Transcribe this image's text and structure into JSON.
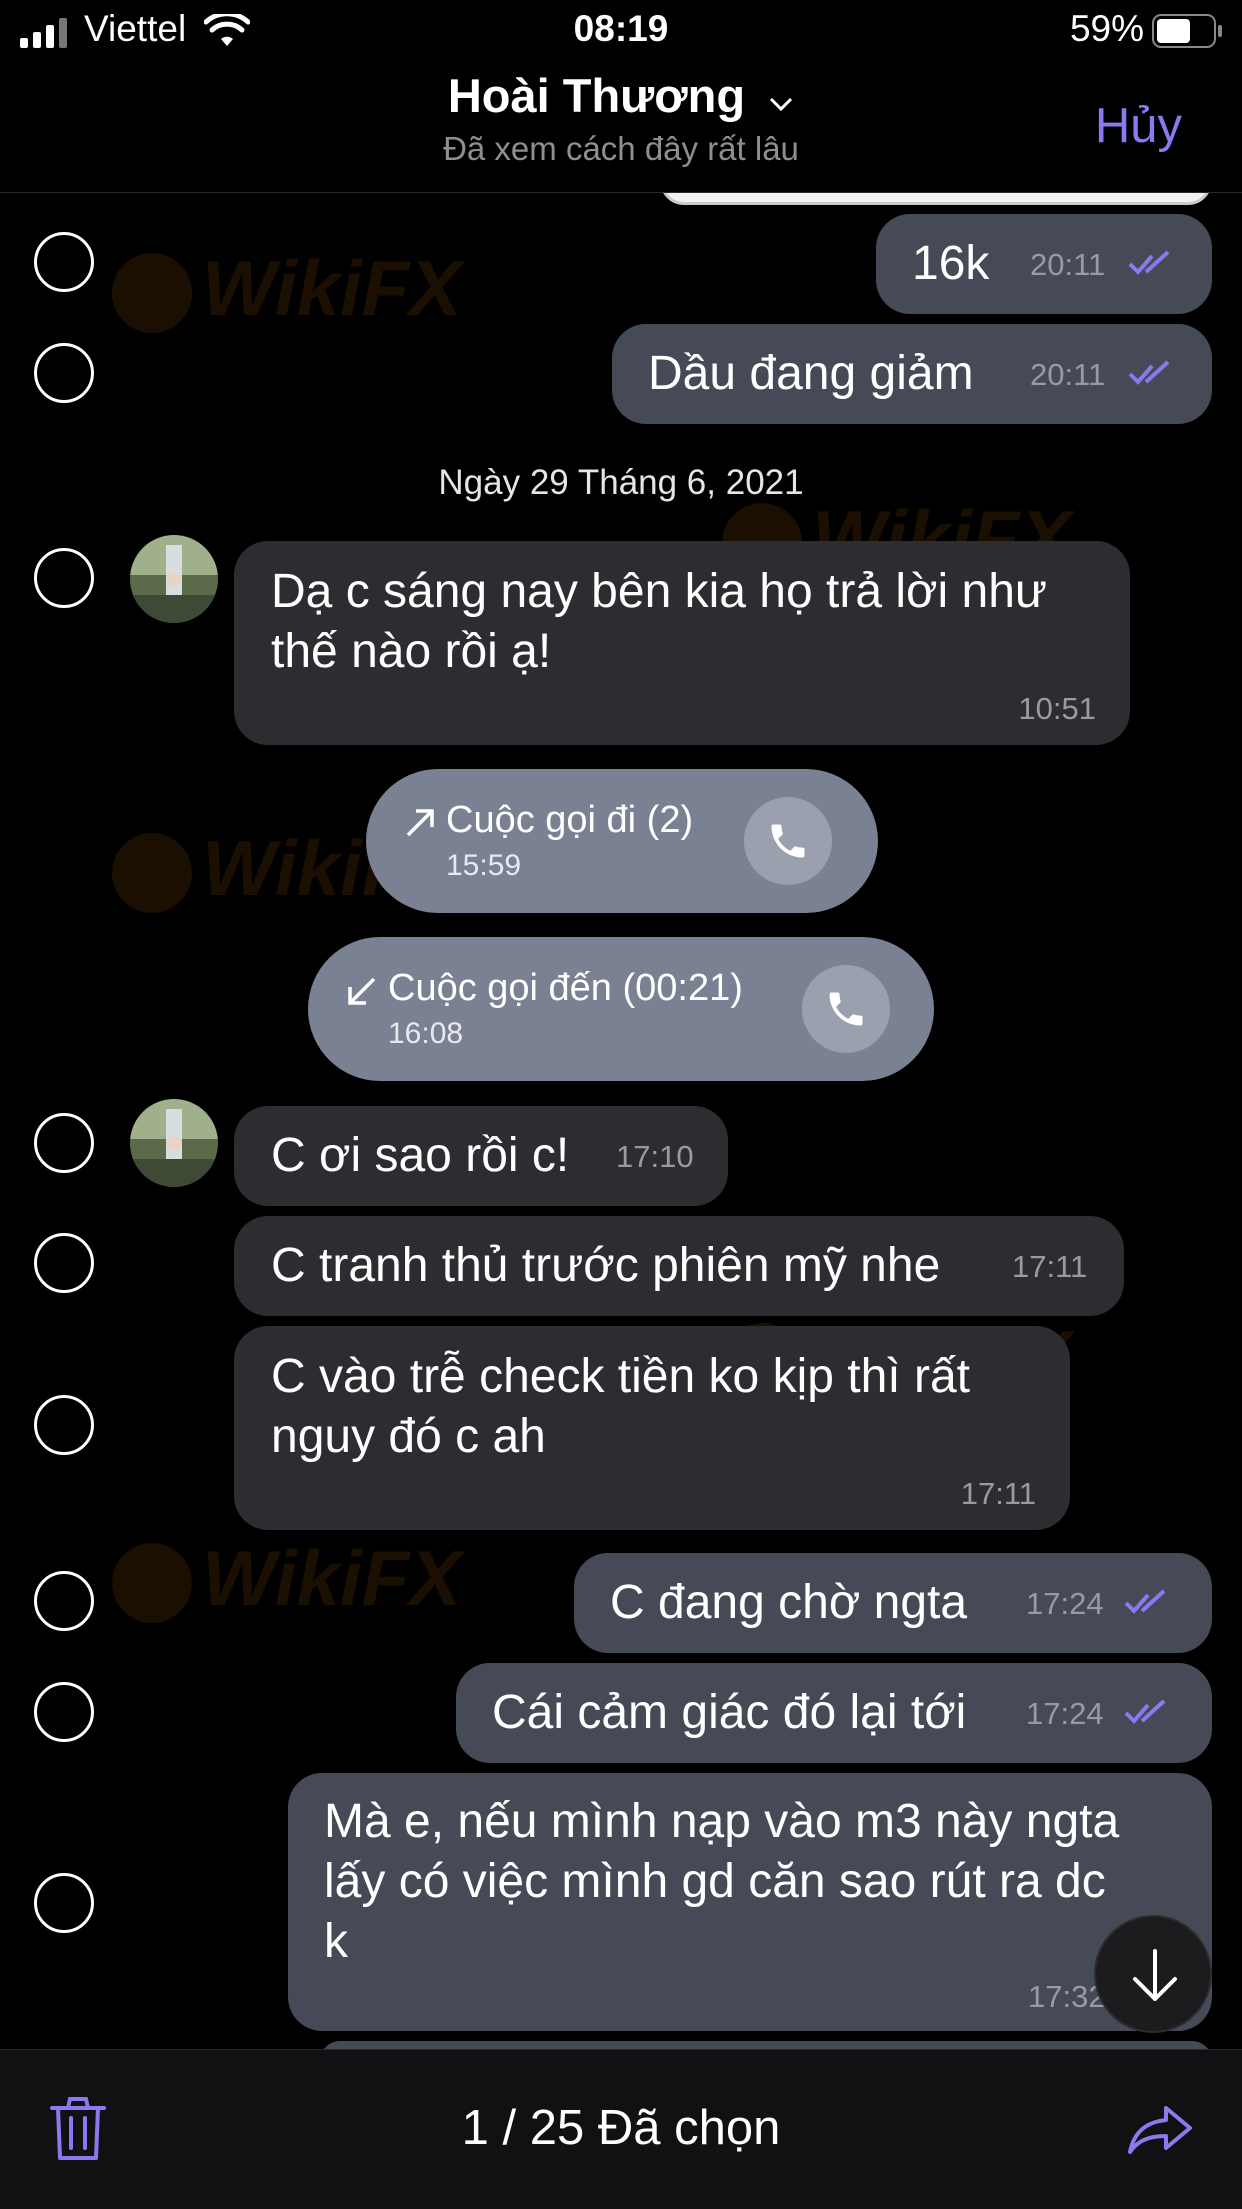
{
  "status_bar": {
    "carrier": "Viettel",
    "time": "08:19",
    "battery": "59%"
  },
  "header": {
    "title": "Hoài Thương",
    "subtitle": "Đã xem cách đây rất lâu",
    "cancel": "Hủy"
  },
  "messages": [
    {
      "text": "16k",
      "time": "20:11",
      "direction": "out"
    },
    {
      "text": "Dầu đang giảm",
      "time": "20:11",
      "direction": "out"
    },
    {
      "text_line1": "Dạ c sáng nay bên kia họ trả lời như",
      "text_line2": "thế nào rồi ạ!",
      "time": "10:51",
      "direction": "in"
    },
    {
      "text": "C ơi sao rồi c!",
      "time": "17:10",
      "direction": "in"
    },
    {
      "text": "C tranh thủ trước phiên mỹ nhe",
      "time": "17:11",
      "direction": "in"
    },
    {
      "text_line1": "C vào trễ check tiền ko kịp thì rất",
      "text_line2": "nguy đó c ah",
      "time": "17:11",
      "direction": "in"
    },
    {
      "text": "C đang chờ ngta",
      "time": "17:24",
      "direction": "out"
    },
    {
      "text": "Cái cảm giác đó lại tới",
      "time": "17:24",
      "direction": "out"
    },
    {
      "text_line1": "Mà e, nếu mình nạp vào m3 này ngta",
      "text_line2": "lấy có việc mình gd căn sao rút ra dc",
      "text_line3": "k",
      "time": "17:32",
      "direction": "out"
    }
  ],
  "date_separator": "Ngày 29 Tháng 6, 2021",
  "calls": [
    {
      "label": "Cuộc gọi đi (2)",
      "time": "15:59",
      "direction": "outgoing"
    },
    {
      "label": "Cuộc gọi đến (00:21)",
      "time": "16:08",
      "direction": "incoming"
    }
  ],
  "bottom_bar": {
    "selected": "1 / 25 Đã chọn"
  },
  "watermark": "WikiFX",
  "colors": {
    "accent": "#8b79f0",
    "outgoing_bubble": "#454a56",
    "incoming_bubble": "#2c2d30",
    "call_bubble": "#7a8192"
  }
}
